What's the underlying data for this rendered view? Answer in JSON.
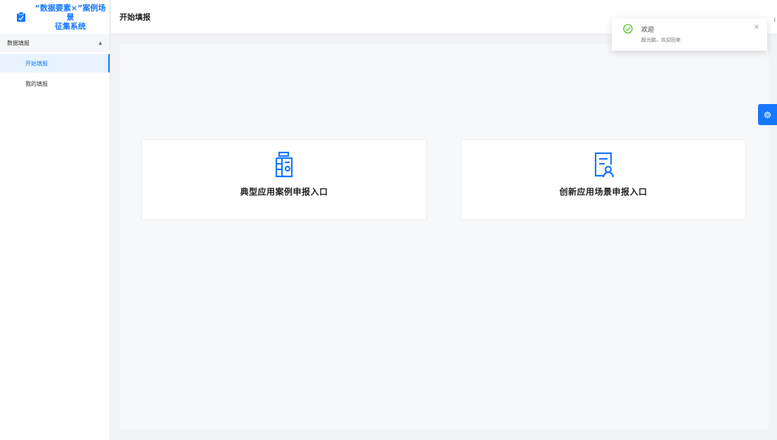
{
  "app": {
    "title": "“数据要素×”案例场景征集系统",
    "title_line1": "“数据要素×”案例场景",
    "title_line2": "征集系统"
  },
  "sidebar": {
    "group": {
      "label": "数据填报",
      "expanded": true
    },
    "items": [
      {
        "label": "开始填报",
        "active": true
      },
      {
        "label": "我的填报",
        "active": false
      }
    ]
  },
  "header": {
    "title": "开始填报",
    "edge_text": "i"
  },
  "cards": [
    {
      "label": "典型应用案例申报入口",
      "icon": "clipboard-icon"
    },
    {
      "label": "创新应用场景申报入口",
      "icon": "document-user-icon"
    }
  ],
  "notification": {
    "title": "欢迎",
    "message": "殷光鹏，欢迎回来",
    "icon": "check-circle-icon",
    "close": "×"
  },
  "colors": {
    "accent": "#1677ff",
    "success": "#52c41a",
    "background": "#f2f3f5"
  }
}
